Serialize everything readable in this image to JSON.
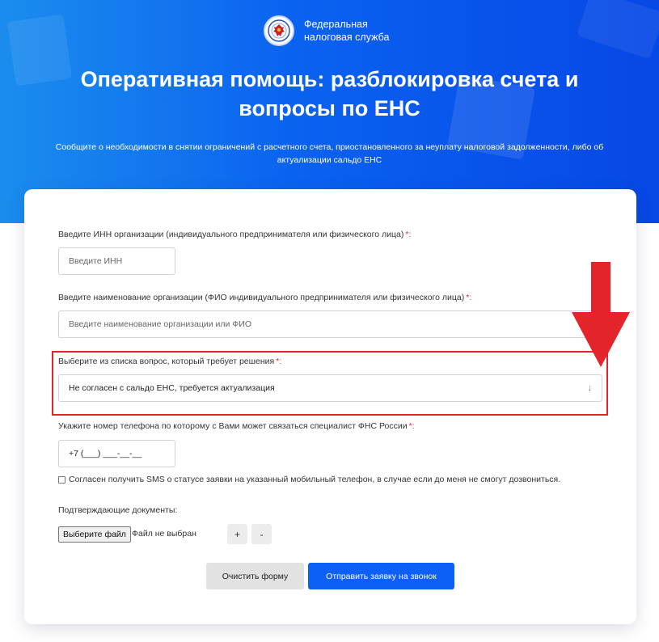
{
  "header": {
    "org_name_line1": "Федеральная",
    "org_name_line2": "налоговая служба",
    "title_line1": "Оперативная помощь: разблокировка счета и",
    "title_line2": "вопросы по ЕНС",
    "subtitle_line1": "Сообщите о необходимости в снятии ограничений с расчетного счета, приостановленного за неуплату налоговой задолженности, либо об",
    "subtitle_line2": "актуализации сальдо ЕНС"
  },
  "form": {
    "inn": {
      "label": "Введите ИНН организации (индивидуального предпринимателя или физического лица)",
      "required_mark": "*:",
      "placeholder": "Введите ИНН"
    },
    "org_name": {
      "label": "Введите наименование организации (ФИО индивидуального предпринимателя или физического лица)",
      "required_mark": "*:",
      "placeholder": "Введите наименование организации или ФИО"
    },
    "question": {
      "label": "Выберите из списка вопрос, который требует решения",
      "required_mark": "*:",
      "selected": "Не согласен с сальдо ЕНС, требуется актуализация",
      "chevron": "↓"
    },
    "phone": {
      "label": "Укажите номер телефона по которому с Вами может связаться специалист ФНС России",
      "required_mark": "*:",
      "value": "+7 (___) ___-__-__"
    },
    "sms_consent": {
      "label": "Согласен получить SMS о статусе заявки на указанный мобильный телефон, в случае если до меня не смогут дозвониться.",
      "checked": false
    },
    "documents": {
      "label": "Подтверждающие документы:",
      "choose_file": "Выберите файл",
      "no_file": "Файл не выбран",
      "add": "+",
      "remove": "-"
    },
    "buttons": {
      "clear": "Очистить форму",
      "submit": "Отправить заявку на звонок"
    }
  },
  "colors": {
    "header_gradient_start": "#1b8dee",
    "header_gradient_end": "#0747e6",
    "primary_button": "#0d5ff5",
    "annotation_red": "#e3242b"
  },
  "icons": {
    "logo": "fns-emblem-icon",
    "annotation": "red-arrow-down-icon"
  }
}
